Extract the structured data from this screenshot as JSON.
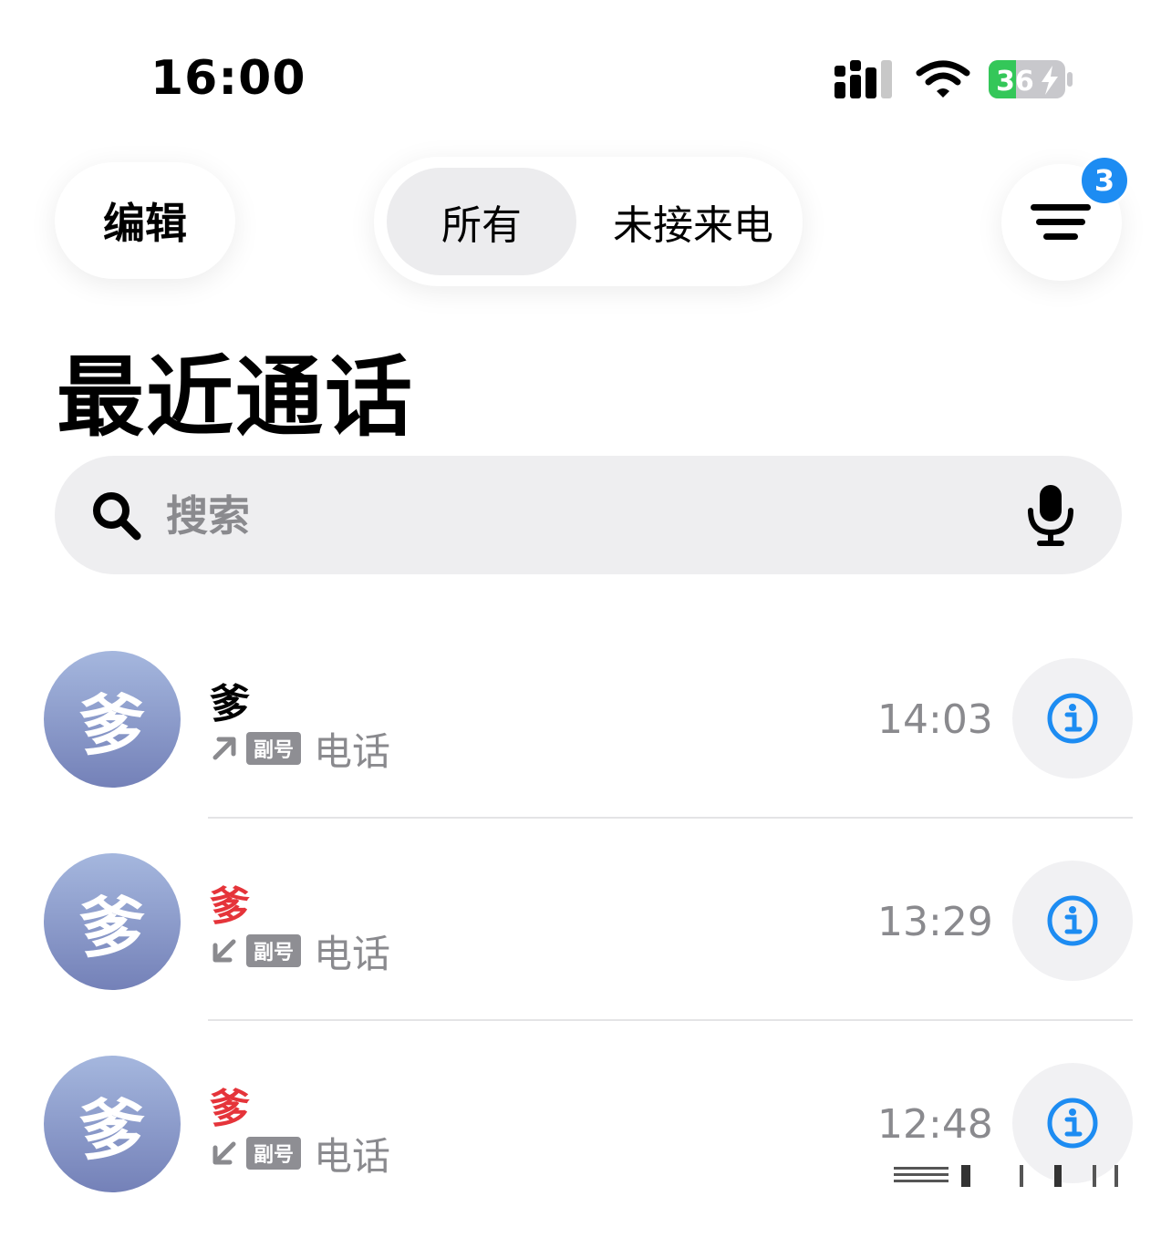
{
  "status_bar": {
    "time": "16:00",
    "battery_level": "36",
    "battery_color": "#34c759"
  },
  "nav": {
    "edit_label": "编辑",
    "segments": [
      {
        "label": "所有",
        "selected": true
      },
      {
        "label": "未接来电",
        "selected": false
      }
    ],
    "filter_badge": "3",
    "badge_color": "#1d8cf2"
  },
  "page_title": "最近通话",
  "search": {
    "placeholder": "搜索",
    "value": ""
  },
  "calls": [
    {
      "avatar_text": "爹",
      "name": "爹",
      "missed": false,
      "direction_icon": "outgoing-arrow-icon",
      "sim_tag": "副号",
      "type": "电话",
      "time": "14:03"
    },
    {
      "avatar_text": "爹",
      "name": "爹",
      "missed": true,
      "direction_icon": "incoming-arrow-icon",
      "sim_tag": "副号",
      "type": "电话",
      "time": "13:29"
    },
    {
      "avatar_text": "爹",
      "name": "爹",
      "missed": true,
      "direction_icon": "incoming-arrow-icon",
      "sim_tag": "副号",
      "type": "电话",
      "time": "12:48"
    }
  ],
  "colors": {
    "missed": "#e5343a",
    "info_accent": "#1d8cf2",
    "secondary_text": "#8a8a8e"
  }
}
